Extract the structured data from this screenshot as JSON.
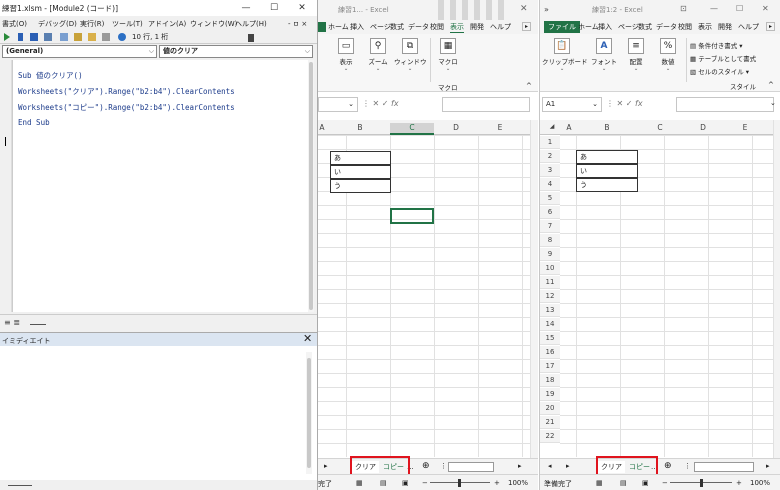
{
  "vbe": {
    "title": "練習1.xlsm - [Module2 (コード)]",
    "win_min": "—",
    "win_max": "☐",
    "win_close": "✕",
    "inner_controls": "- ㅁ ×",
    "menu": [
      "書式(O)",
      "デバッグ(D)",
      "実行(R)",
      "ツール(T)",
      "アドイン(A)",
      "ウィンドウ(W)",
      "ヘルプ(H)"
    ],
    "position": "10 行, 1 桁",
    "object_combo": "(General)",
    "proc_combo": "値のクリア",
    "code": [
      "Sub 値のクリア()",
      "Worksheets(\"クリア\").Range(\"b2:b4\").ClearContents",
      "Worksheets(\"コピー\").Range(\"b2:b4\").ClearContents",
      "End Sub"
    ],
    "view_icons": "≡ ≣",
    "immediate_title": "イミディエイト",
    "immediate_close": "✕"
  },
  "excel_left": {
    "title": "練習1... - Excel",
    "tabs": [
      "ホーム",
      "挿入",
      "ページ",
      "数式",
      "データ",
      "校閲",
      "表示",
      "開発",
      "ヘルプ"
    ],
    "active_tab": "表示",
    "ribbon_buttons": [
      "表示",
      "ズーム",
      "ウィンドウ",
      "マクロ"
    ],
    "ribbon_group": "マクロ",
    "columns": [
      "A",
      "B",
      "C",
      "D",
      "E"
    ],
    "cells": [
      "あ",
      "い",
      "う"
    ],
    "sheet_tabs": [
      "クリア",
      "コピー",
      "..."
    ],
    "status": "完了",
    "zoom": "100%"
  },
  "excel_right": {
    "title": "練習1:2 - Excel",
    "tabs": [
      "ファイル",
      "ホーム",
      "挿入",
      "ページ",
      "数式",
      "データ",
      "校閲",
      "表示",
      "開発",
      "ヘルプ"
    ],
    "ribbon_buttons": [
      "クリップボード",
      "フォント",
      "配置",
      "数値"
    ],
    "style_items": [
      "条件付き書式 ▾",
      "テーブルとして書式",
      "セルのスタイル ▾"
    ],
    "ribbon_group": "スタイル",
    "name_box": "A1",
    "columns": [
      "A",
      "B",
      "C",
      "D",
      "E"
    ],
    "rows": [
      "1",
      "2",
      "3",
      "4",
      "5",
      "6",
      "7",
      "8",
      "9",
      "10",
      "11",
      "12",
      "13",
      "14",
      "15",
      "16",
      "17",
      "18",
      "19",
      "20",
      "21",
      "22"
    ],
    "cells": [
      "あ",
      "い",
      "う"
    ],
    "sheet_tabs": [
      "クリア",
      "コピー",
      "..."
    ],
    "status": "準備完了",
    "zoom": "100%"
  },
  "colors": {
    "excel_green": "#217346",
    "highlight_red": "#e0141e",
    "code_blue": "#1b3a8a"
  }
}
